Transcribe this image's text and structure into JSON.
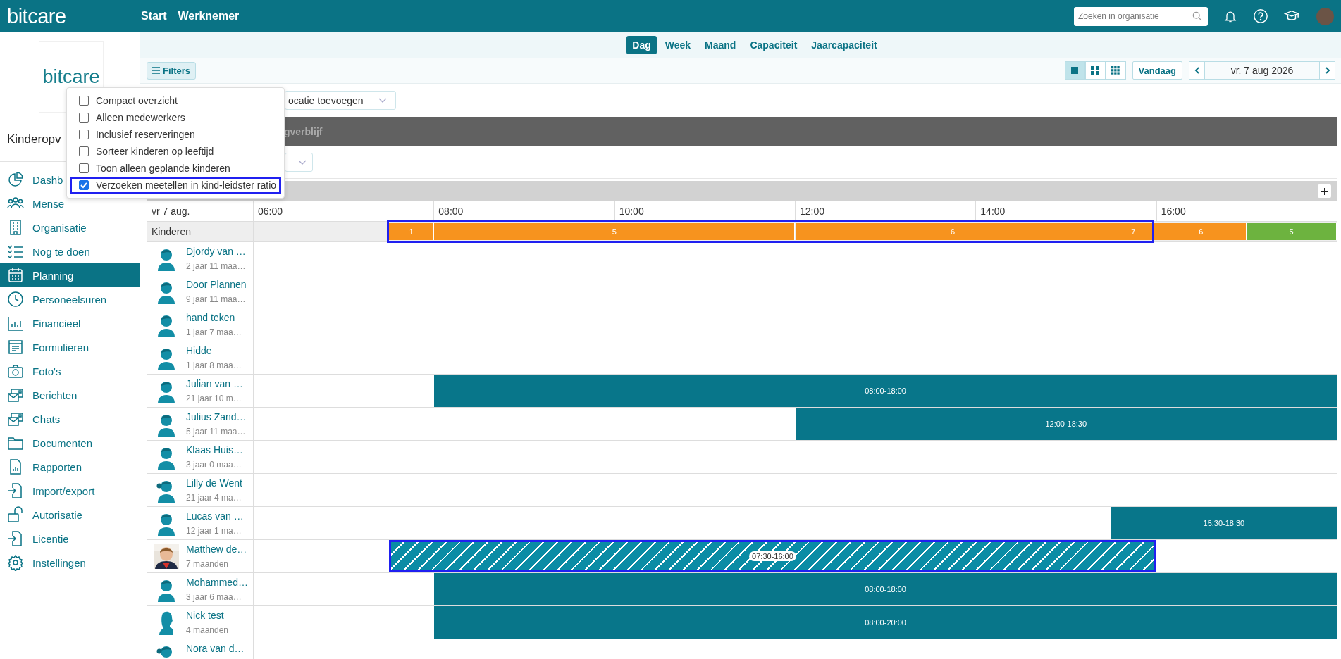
{
  "topbar": {
    "logo": "bitcare",
    "nav": [
      {
        "label": "Start"
      },
      {
        "label": "Werknemer"
      }
    ],
    "search": {
      "placeholder": "Zoeken in organisatie"
    }
  },
  "sidebar": {
    "logo": "bitcare",
    "org_name": "Kinderopv",
    "items": [
      {
        "label": "Dashb",
        "selected": false
      },
      {
        "label": "Mense",
        "selected": false
      },
      {
        "label": "Organisatie",
        "selected": false
      },
      {
        "label": "Nog te doen",
        "selected": false
      },
      {
        "label": "Planning",
        "selected": true
      },
      {
        "label": "Personeelsuren",
        "selected": false
      },
      {
        "label": "Financieel",
        "selected": false
      },
      {
        "label": "Formulieren",
        "selected": false
      },
      {
        "label": "Foto's",
        "selected": false
      },
      {
        "label": "Berichten",
        "selected": false
      },
      {
        "label": "Chats",
        "selected": false
      },
      {
        "label": "Documenten",
        "selected": false
      },
      {
        "label": "Rapporten",
        "selected": false
      },
      {
        "label": "Import/export",
        "selected": false
      },
      {
        "label": "Autorisatie",
        "selected": false
      },
      {
        "label": "Licentie",
        "selected": false
      },
      {
        "label": "Instellingen",
        "selected": false
      }
    ]
  },
  "view_tabs": [
    {
      "label": "Dag",
      "selected": true
    },
    {
      "label": "Week",
      "selected": false
    },
    {
      "label": "Maand",
      "selected": false
    },
    {
      "label": "Capaciteit",
      "selected": false
    },
    {
      "label": "Jaarcapaciteit",
      "selected": false
    }
  ],
  "toolbar": {
    "filters": "Filters",
    "layouts": [
      {
        "kind": "single",
        "selected": true
      },
      {
        "kind": "grid4",
        "selected": false
      },
      {
        "kind": "grid9",
        "selected": false
      }
    ],
    "today": "Vandaag",
    "date": "vr. 7 aug 2026"
  },
  "filter_menu": {
    "options": [
      {
        "label": "Compact overzicht",
        "checked": false,
        "highlighted": false
      },
      {
        "label": "Alleen medewerkers",
        "checked": false,
        "highlighted": false
      },
      {
        "label": "Inclusief reserveringen",
        "checked": false,
        "highlighted": false
      },
      {
        "label": "Sorteer kinderen op leeftijd",
        "checked": false,
        "highlighted": false
      },
      {
        "label": "Toon alleen geplande kinderen",
        "checked": false,
        "highlighted": false
      },
      {
        "label": "Verzoeken meetellen in kind-leidster ratio",
        "checked": true,
        "highlighted": true
      }
    ]
  },
  "location_select": {
    "value": "ocatie toevoegen"
  },
  "group": {
    "title": "gverblijf"
  },
  "schedule": {
    "date_label": "vr 7 aug.",
    "ticks": [
      "06:00",
      "08:00",
      "10:00",
      "12:00",
      "14:00",
      "16:00"
    ],
    "ratio_row": {
      "label": "Kinderen",
      "segments": [
        {
          "count": "1",
          "color": "#f7931e",
          "highlighted": true
        },
        {
          "count": "5",
          "color": "#f7931e",
          "highlighted": true
        },
        {
          "count": "6",
          "color": "#f7931e",
          "highlighted": true
        },
        {
          "count": "7",
          "color": "#f7931e",
          "highlighted": true
        },
        {
          "count": "6",
          "color": "#f7931e",
          "highlighted": false
        },
        {
          "count": "5",
          "color": "#6db33f",
          "highlighted": false
        }
      ]
    },
    "children": [
      {
        "name": "Djordy van …",
        "age": "2 jaar 11 maa…",
        "kind": "boy"
      },
      {
        "name": "Door Plannen",
        "age": "9 jaar 11 maa…",
        "kind": "boy"
      },
      {
        "name": "hand teken",
        "age": "1 jaar 7 maa…",
        "kind": "boy"
      },
      {
        "name": "Hidde",
        "age": "1 jaar 8 maa…",
        "kind": "boy"
      },
      {
        "name": "Julian van …",
        "age": "21 jaar 10 m…",
        "kind": "boy",
        "bar": {
          "label": "08:00-18:00",
          "kind": "planned",
          "highlighted": false
        }
      },
      {
        "name": "Julius Zand…",
        "age": "5 jaar 11 maa…",
        "kind": "boy",
        "bar": {
          "label": "12:00-18:30",
          "kind": "planned",
          "highlighted": false
        }
      },
      {
        "name": "Klaas Huis…",
        "age": "3 jaar 0 maa…",
        "kind": "boy"
      },
      {
        "name": "Lilly de Went",
        "age": "21 jaar 4 ma…",
        "kind": "girl"
      },
      {
        "name": "Lucas van …",
        "age": "12 jaar 1 ma…",
        "kind": "boy",
        "bar": {
          "label": "15:30-18:30",
          "kind": "planned",
          "highlighted": false
        }
      },
      {
        "name": "Matthew de…",
        "age": "7 maanden",
        "bar": {
          "label": "07:30-16:00",
          "kind": "request",
          "highlighted": true
        }
      },
      {
        "name": "Mohammed…",
        "age": "3 jaar 6 maa…",
        "kind": "boy",
        "bar": {
          "label": "08:00-18:00",
          "kind": "planned",
          "highlighted": false
        }
      },
      {
        "name": "Nick test",
        "age": "4 maanden",
        "kind": "person",
        "bar": {
          "label": "08:00-20:00",
          "kind": "planned",
          "highlighted": false
        }
      },
      {
        "name": "Nora van d…",
        "kind": "girl"
      }
    ]
  }
}
